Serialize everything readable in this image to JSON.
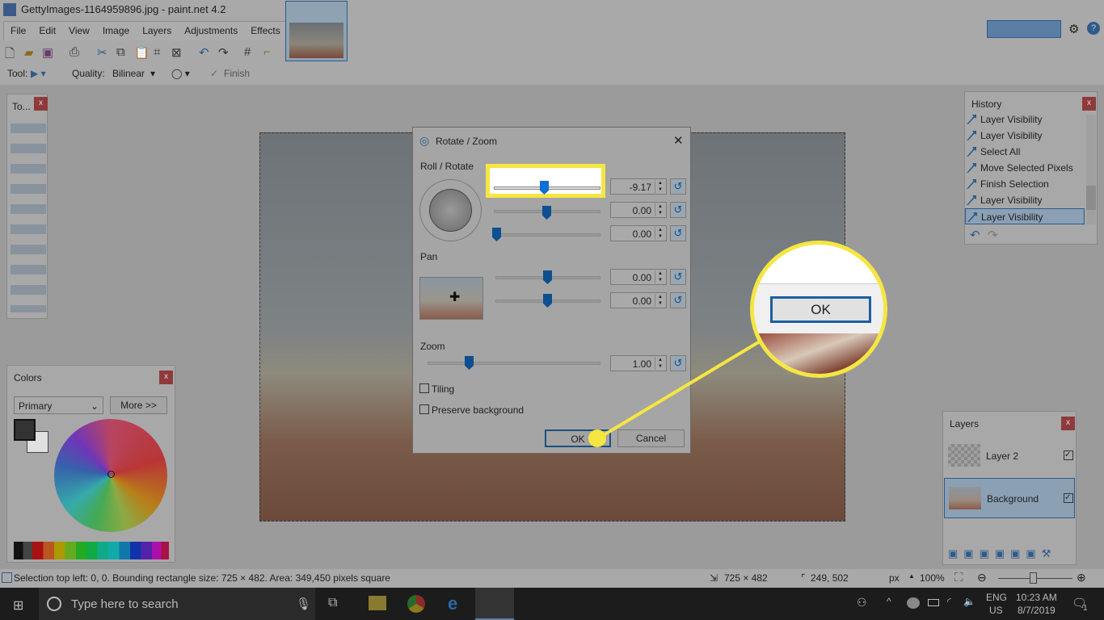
{
  "app": {
    "title": "GettyImages-1164959896.jpg - paint.net 4.2"
  },
  "menu": [
    "File",
    "Edit",
    "View",
    "Image",
    "Layers",
    "Adjustments",
    "Effects"
  ],
  "tool_options": {
    "tool_label": "Tool:",
    "quality_label": "Quality:",
    "quality_value": "Bilinear",
    "finish_label": "Finish"
  },
  "tools_panel": {
    "title": "To...",
    "close": "x"
  },
  "colors_panel": {
    "title": "Colors",
    "close": "x",
    "mode": "Primary",
    "more": "More >>"
  },
  "history_panel": {
    "title": "History",
    "close": "x",
    "items": [
      "Layer Visibility",
      "Layer Visibility",
      "Select All",
      "Move Selected Pixels",
      "Finish Selection",
      "Layer Visibility",
      "Layer Visibility"
    ],
    "selected_index": 6
  },
  "layers_panel": {
    "title": "Layers",
    "close": "x",
    "layers": [
      {
        "name": "Layer 2",
        "visible": true
      },
      {
        "name": "Background",
        "visible": true,
        "selected": true
      }
    ]
  },
  "dialog": {
    "title": "Rotate / Zoom",
    "close": "✕",
    "roll_label": "Roll / Rotate",
    "roll_values": [
      "-9.17",
      "0.00",
      "0.00"
    ],
    "pan_label": "Pan",
    "pan_values": [
      "0.00",
      "0.00"
    ],
    "zoom_label": "Zoom",
    "zoom_value": "1.00",
    "tiling_label": "Tiling",
    "tiling_checked": false,
    "preserve_label": "Preserve background",
    "preserve_checked": false,
    "ok": "OK",
    "cancel": "Cancel"
  },
  "callout": {
    "label": "OK",
    "highlight_color": "#f5e642"
  },
  "status": {
    "text": "Selection top left: 0, 0. Bounding rectangle size: 725 × 482. Area: 349,450 pixels square",
    "size": "725 × 482",
    "cursor": "249, 502",
    "unit": "px",
    "zoom": "100%"
  },
  "taskbar": {
    "search_placeholder": "Type here to search",
    "lang1": "ENG",
    "lang2": "US",
    "time": "10:23 AM",
    "date": "8/7/2019",
    "notifications": "1"
  }
}
